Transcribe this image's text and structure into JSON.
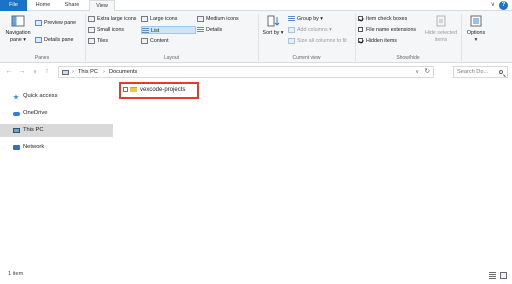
{
  "ribbon_tabs": {
    "file": "File",
    "home": "Home",
    "share": "Share",
    "view": "View"
  },
  "panes": {
    "navigation_pane": "Navigation pane",
    "preview_pane": "Preview pane",
    "details_pane": "Details pane",
    "group_label": "Panes"
  },
  "layout": {
    "extra_large_icons": "Extra large icons",
    "large_icons": "Large icons",
    "medium_icons": "Medium icons",
    "small_icons": "Small icons",
    "list": "List",
    "details": "Details",
    "tiles": "Tiles",
    "content": "Content",
    "group_label": "Layout",
    "selected": "List"
  },
  "current_view": {
    "sort_by": "Sort by",
    "group_by": "Group by",
    "add_columns": "Add columns",
    "size_all_columns": "Size all columns to fit",
    "group_label": "Current view"
  },
  "show_hide": {
    "item_check_boxes": {
      "label": "Item check boxes",
      "checked": true
    },
    "file_name_extensions": {
      "label": "File name extensions",
      "checked": false
    },
    "hidden_items": {
      "label": "Hidden items",
      "checked": true
    },
    "hide_selected_items": "Hide selected items",
    "group_label": "Show/hide"
  },
  "options": "Options",
  "address": {
    "breadcrumbs": [
      "This PC",
      "Documents"
    ],
    "search_placeholder": "Search Do..."
  },
  "nav_pane": {
    "items": [
      {
        "label": "Quick access",
        "icon": "star-icon"
      },
      {
        "label": "OneDrive",
        "icon": "cloud-icon"
      },
      {
        "label": "This PC",
        "icon": "monitor-icon",
        "selected": true
      },
      {
        "label": "Network",
        "icon": "network-icon"
      }
    ]
  },
  "files": [
    {
      "name": "vexcode-projects",
      "type": "folder"
    }
  ],
  "status": {
    "item_count": "1 item"
  },
  "colors": {
    "file_tab": "#1a73c8",
    "highlight_box": "#e43b2c",
    "selected_nav": "#d9d9d9",
    "selected_layout": "#cce4f7"
  }
}
